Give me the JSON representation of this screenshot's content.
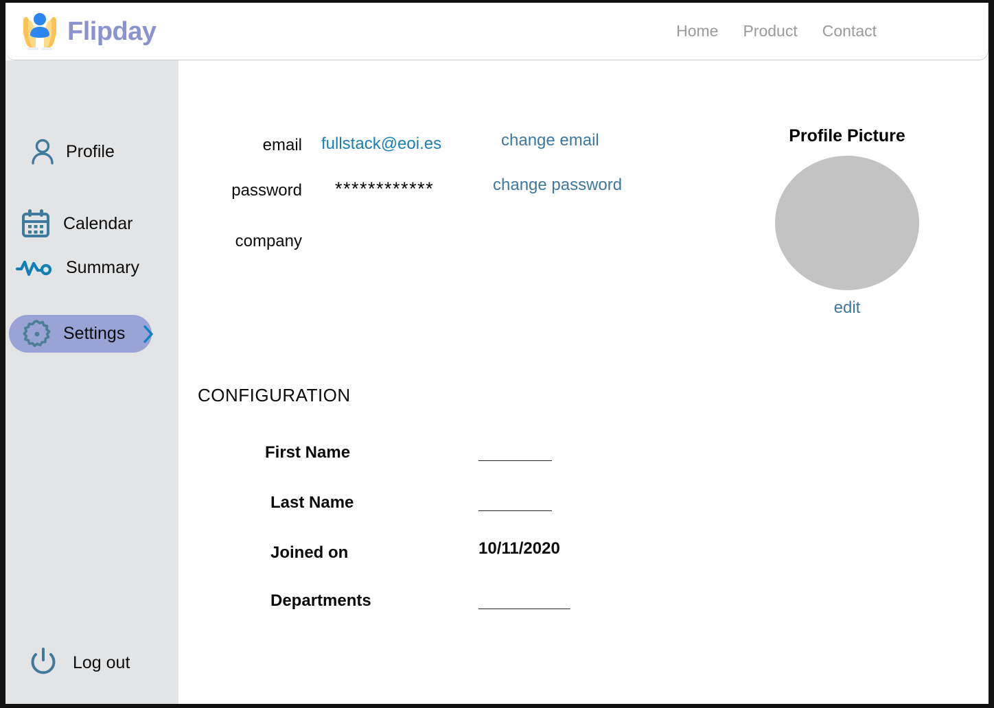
{
  "header": {
    "brand_name": "Flipday",
    "logo_icon": "hands-holding-person-icon",
    "nav": [
      {
        "label": "Home"
      },
      {
        "label": "Product"
      },
      {
        "label": "Contact"
      }
    ]
  },
  "sidebar": {
    "items": [
      {
        "label": "Profile",
        "icon": "person-icon",
        "active": false
      },
      {
        "label": "Calendar",
        "icon": "calendar-icon",
        "active": false
      },
      {
        "label": "Summary",
        "icon": "waveform-icon",
        "active": false
      },
      {
        "label": "Settings",
        "icon": "gear-icon",
        "active": true,
        "chevron": "chevron-right-icon"
      }
    ],
    "logout": {
      "label": "Log out",
      "icon": "power-icon"
    },
    "active_pill_color": "#9aa3d6",
    "background_color": "#e3e4e6"
  },
  "account": {
    "email": {
      "label": "email",
      "value": "fullstack@eoi.es",
      "action": "change email"
    },
    "password": {
      "label": "password",
      "value": "************",
      "action": "change password"
    },
    "company": {
      "label": "company",
      "value": ""
    }
  },
  "profile_picture": {
    "title": "Profile Picture",
    "edit_label": "edit",
    "placeholder_color": "#c3c3c3"
  },
  "configuration": {
    "title": "CONFIGURATION",
    "fields": [
      {
        "label": "First Name",
        "value": "________"
      },
      {
        "label": "Last Name",
        "value": "________"
      },
      {
        "label": "Joined on",
        "value": "10/11/2020"
      },
      {
        "label": "Departments",
        "value": "__________"
      }
    ]
  },
  "colors": {
    "brand": "#8a93cf",
    "link_blue": "#1a7fb5",
    "action_blue": "#3d78a0",
    "icon_slate": "#3f7a9c",
    "nav_gray": "#9a9a9a"
  }
}
